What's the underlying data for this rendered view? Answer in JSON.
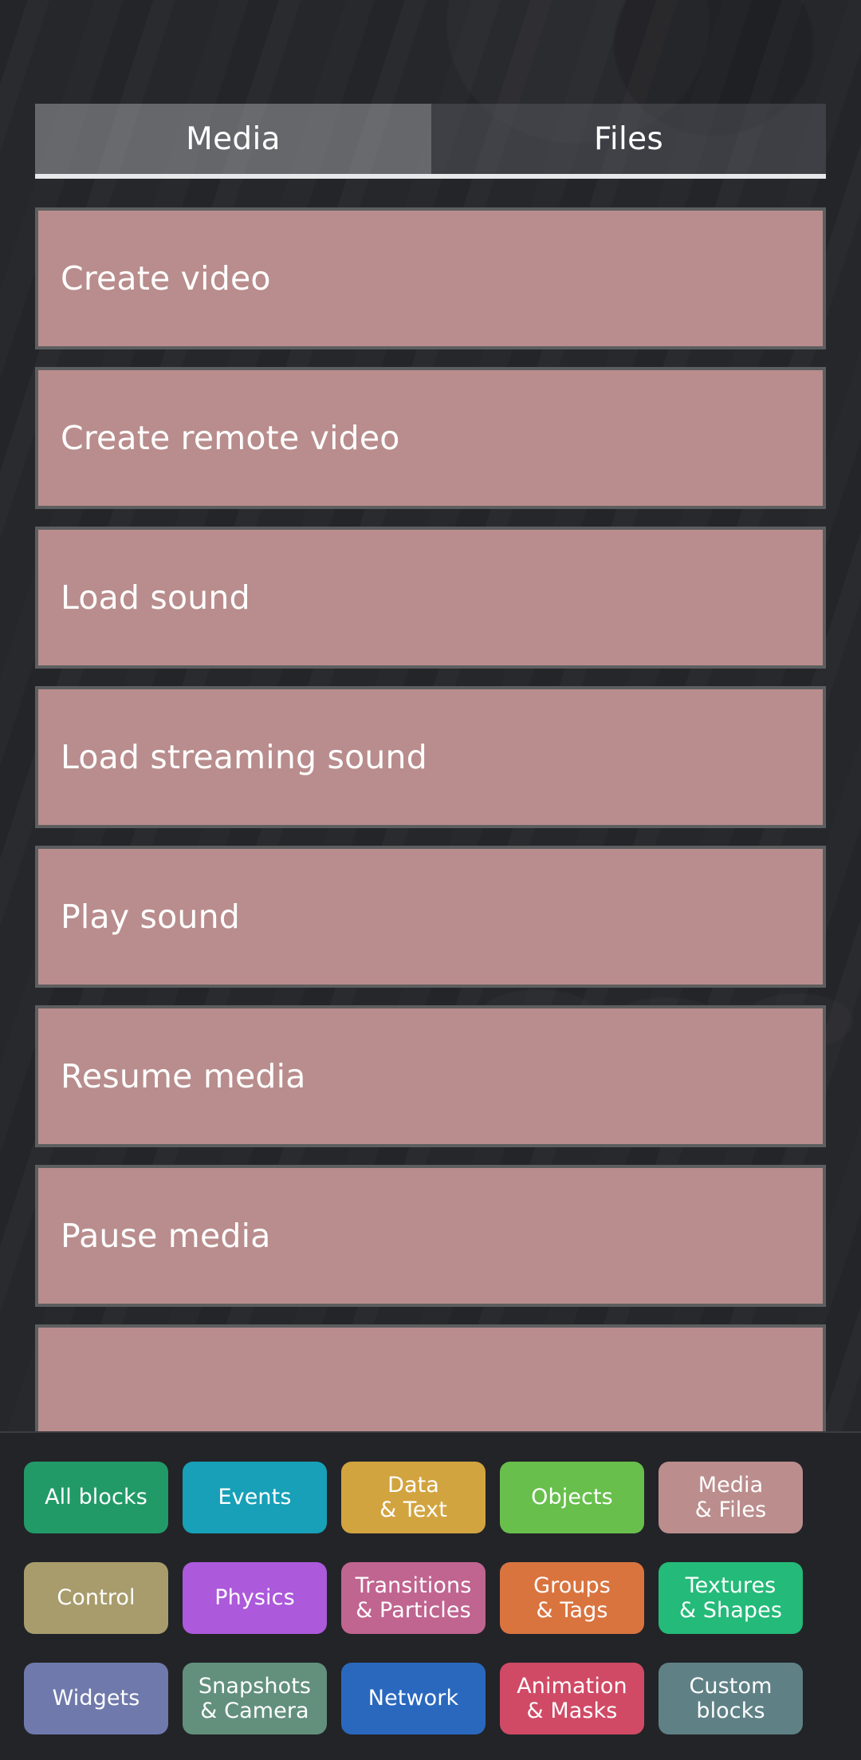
{
  "app": {
    "background_color": "#26272b",
    "panel_color": "#232428"
  },
  "tabs": {
    "items": [
      {
        "label": "Media",
        "active": true
      },
      {
        "label": "Files",
        "active": false
      }
    ]
  },
  "block_list": {
    "accent_color": "#b98d8d",
    "border_color": "#5c5e5f",
    "items": [
      {
        "label": "Create video"
      },
      {
        "label": "Create remote video"
      },
      {
        "label": "Load sound"
      },
      {
        "label": "Load streaming sound"
      },
      {
        "label": "Play sound"
      },
      {
        "label": "Resume media"
      },
      {
        "label": "Pause media"
      },
      {
        "label": ""
      }
    ]
  },
  "categories": {
    "rows": [
      [
        {
          "label": "All blocks",
          "color": "#229a68",
          "active": false
        },
        {
          "label": "Events",
          "color": "#17a0b8",
          "active": false
        },
        {
          "label": "Data\n& Text",
          "color": "#d2a440",
          "active": false
        },
        {
          "label": "Objects",
          "color": "#68bf4c",
          "active": false
        },
        {
          "label": "Media\n& Files",
          "color": "#bb8d8d",
          "active": true
        }
      ],
      [
        {
          "label": "Control",
          "color": "#a89c6c",
          "active": false
        },
        {
          "label": "Physics",
          "color": "#ac59db",
          "active": false
        },
        {
          "label": "Transitions\n& Particles",
          "color": "#c06490",
          "active": false
        },
        {
          "label": "Groups\n& Tags",
          "color": "#d9743f",
          "active": false
        },
        {
          "label": "Textures\n& Shapes",
          "color": "#24ba79",
          "active": false
        }
      ],
      [
        {
          "label": "Widgets",
          "color": "#6f79ab",
          "active": false
        },
        {
          "label": "Snapshots\n& Camera",
          "color": "#62907c",
          "active": false
        },
        {
          "label": "Network",
          "color": "#2a68be",
          "active": false
        },
        {
          "label": "Animation\n& Masks",
          "color": "#d04a66",
          "active": false
        },
        {
          "label": "Custom\nblocks",
          "color": "#5f8186",
          "active": false
        }
      ]
    ]
  }
}
